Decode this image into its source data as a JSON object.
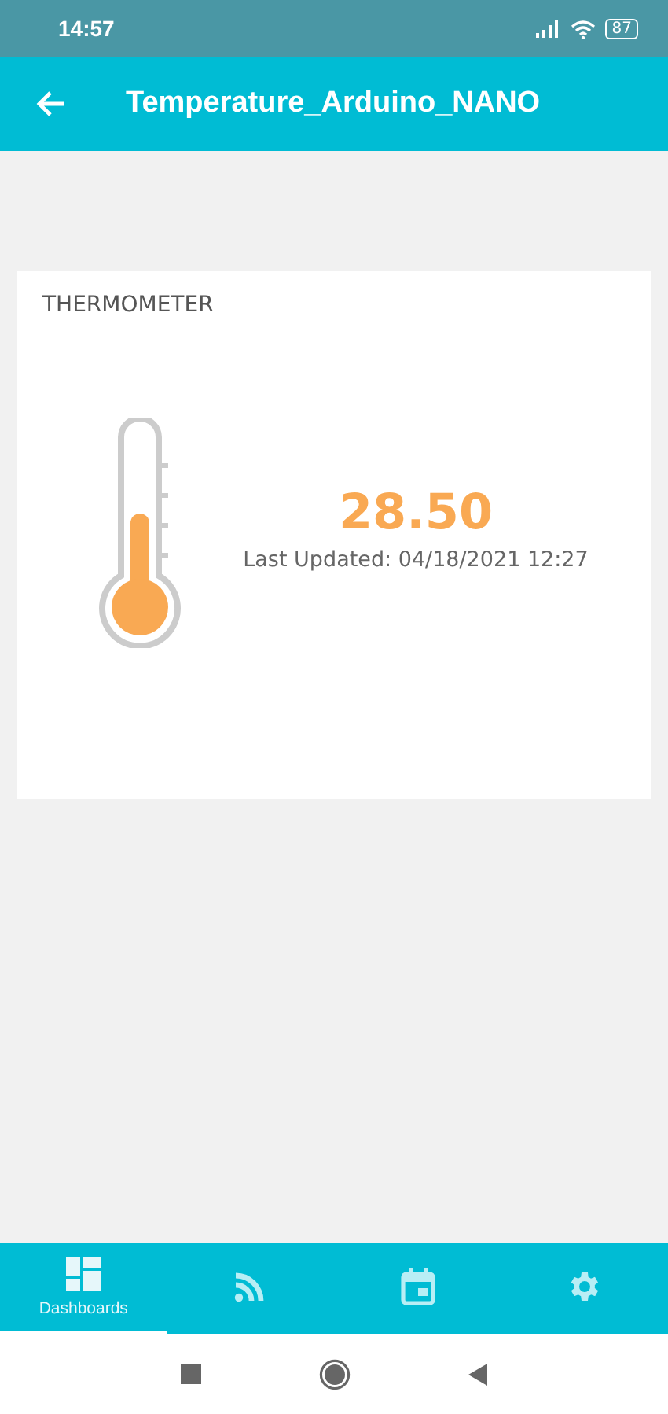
{
  "status_bar": {
    "time": "14:57",
    "battery": "87"
  },
  "header": {
    "title": "Temperature_Arduino_NANO"
  },
  "card": {
    "title": "THERMOMETER",
    "value": "28.50",
    "updated": "Last Updated: 04/18/2021 12:27",
    "level": 0.45
  },
  "bottom_nav": [
    {
      "kind": "dashboards",
      "label": "Dashboards",
      "selected": true
    },
    {
      "kind": "feeds",
      "selected": false
    },
    {
      "kind": "calendar",
      "selected": false
    },
    {
      "kind": "settings",
      "selected": false
    }
  ]
}
